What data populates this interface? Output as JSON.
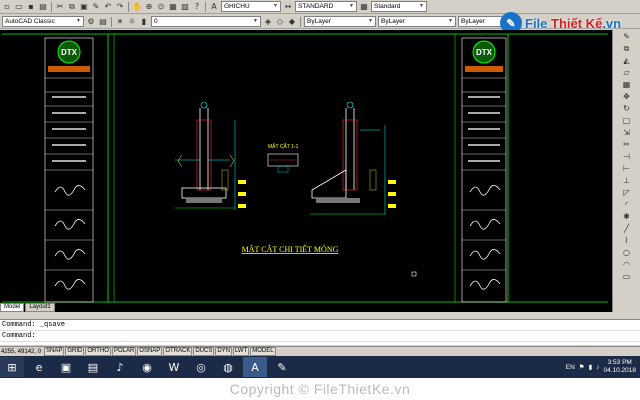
{
  "toolbar": {
    "workspace": "AutoCAD Classic",
    "layer_value": "0",
    "textstyle": "GHICHU",
    "dimstyle": "STANDARD",
    "tablestyle": "Standard",
    "color": "ByLayer",
    "linetype": "ByLayer",
    "lineweight": "ByLayer"
  },
  "logo": {
    "brand_a": "File ",
    "brand_b": "Thiết Kế",
    "brand_c": ".vn"
  },
  "drawing": {
    "title_main": "MẶT CẮT CHI TIẾT MÓNG",
    "section_a": "MẶT CẮT 1-1",
    "stamp": "DTX",
    "accent": "#00ff00"
  },
  "layout_tabs": [
    "Model",
    "Layout1"
  ],
  "command": {
    "line1": "Command: _qsave",
    "line2": "Command:"
  },
  "status": {
    "coords": "4255, 49142, 0",
    "buttons": [
      "SNAP",
      "GRID",
      "ORTHO",
      "POLAR",
      "OSNAP",
      "OTRACK",
      "DUCS",
      "DYN",
      "LWT",
      "MODEL"
    ]
  },
  "taskbar": {
    "lang": "EN",
    "time": "3:53 PM",
    "date": "04.10.2018"
  },
  "watermark": "Copyright © FileThietKe.vn"
}
